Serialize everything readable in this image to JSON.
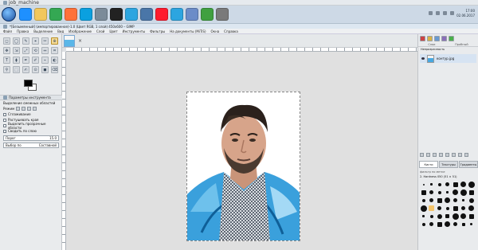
{
  "browser": {
    "tab_title": "job_machine"
  },
  "taskbar": {
    "apps": [
      {
        "icon": "ie-icon",
        "color": "#1e90ff"
      },
      {
        "icon": "explorer-icon",
        "color": "#f2c75c"
      },
      {
        "icon": "chrome-icon",
        "color": "#34a853"
      },
      {
        "icon": "firefox-icon",
        "color": "#ff7139"
      },
      {
        "icon": "windows-icon",
        "color": "#0aa0e0"
      },
      {
        "icon": "alien-icon",
        "color": "#7b8b99"
      },
      {
        "icon": "v-icon",
        "color": "#222222"
      },
      {
        "icon": "telegram-icon",
        "color": "#2ca5e0"
      },
      {
        "icon": "vk-icon",
        "color": "#4a76a8"
      },
      {
        "icon": "opera-icon",
        "color": "#ff1b2d"
      },
      {
        "icon": "telegram-icon",
        "color": "#2ca5e0"
      },
      {
        "icon": "mail-icon",
        "color": "#6b8cc8"
      },
      {
        "icon": "green-icon",
        "color": "#40a040"
      },
      {
        "icon": "gimp-icon",
        "color": "#7a7a7a"
      }
    ],
    "clock_time": "17:00",
    "clock_date": "02.06.2017"
  },
  "gimp": {
    "title": "*[Безымянный] (импортированное)-1.0 (Цвет RGB, 1 слой) 450x600 – GIMP",
    "menu": [
      "Файл",
      "Правка",
      "Выделение",
      "Вид",
      "Изображение",
      "Слой",
      "Цвет",
      "Инструменты",
      "Фильтры",
      "На документы (MiTiS)",
      "Окна",
      "Справка"
    ],
    "options": {
      "header": "Параметры инструмента",
      "title": "Выделение смежных областей",
      "mode_label": "Режим",
      "antialias": "Сглаживание",
      "feather": "Растушевать края",
      "sample_merged": "Выделить прозрачные области",
      "sample_all": "Сводить по слою",
      "threshold_label": "Порог",
      "threshold_value": "15.0",
      "select_by_label": "Выбор по",
      "select_by_value": "Составной"
    },
    "dock": {
      "tab_left": "Слои",
      "tab_right": "Пробный",
      "mode": "Непрозрачность",
      "layer_name": "контур.jpg",
      "brush_tabs": [
        "Кисти",
        "Текстуры",
        "Градиенты"
      ],
      "brush_filter": "фильтр по метке",
      "brush_name": "2. Hardness 050 (51 × 51)"
    }
  }
}
